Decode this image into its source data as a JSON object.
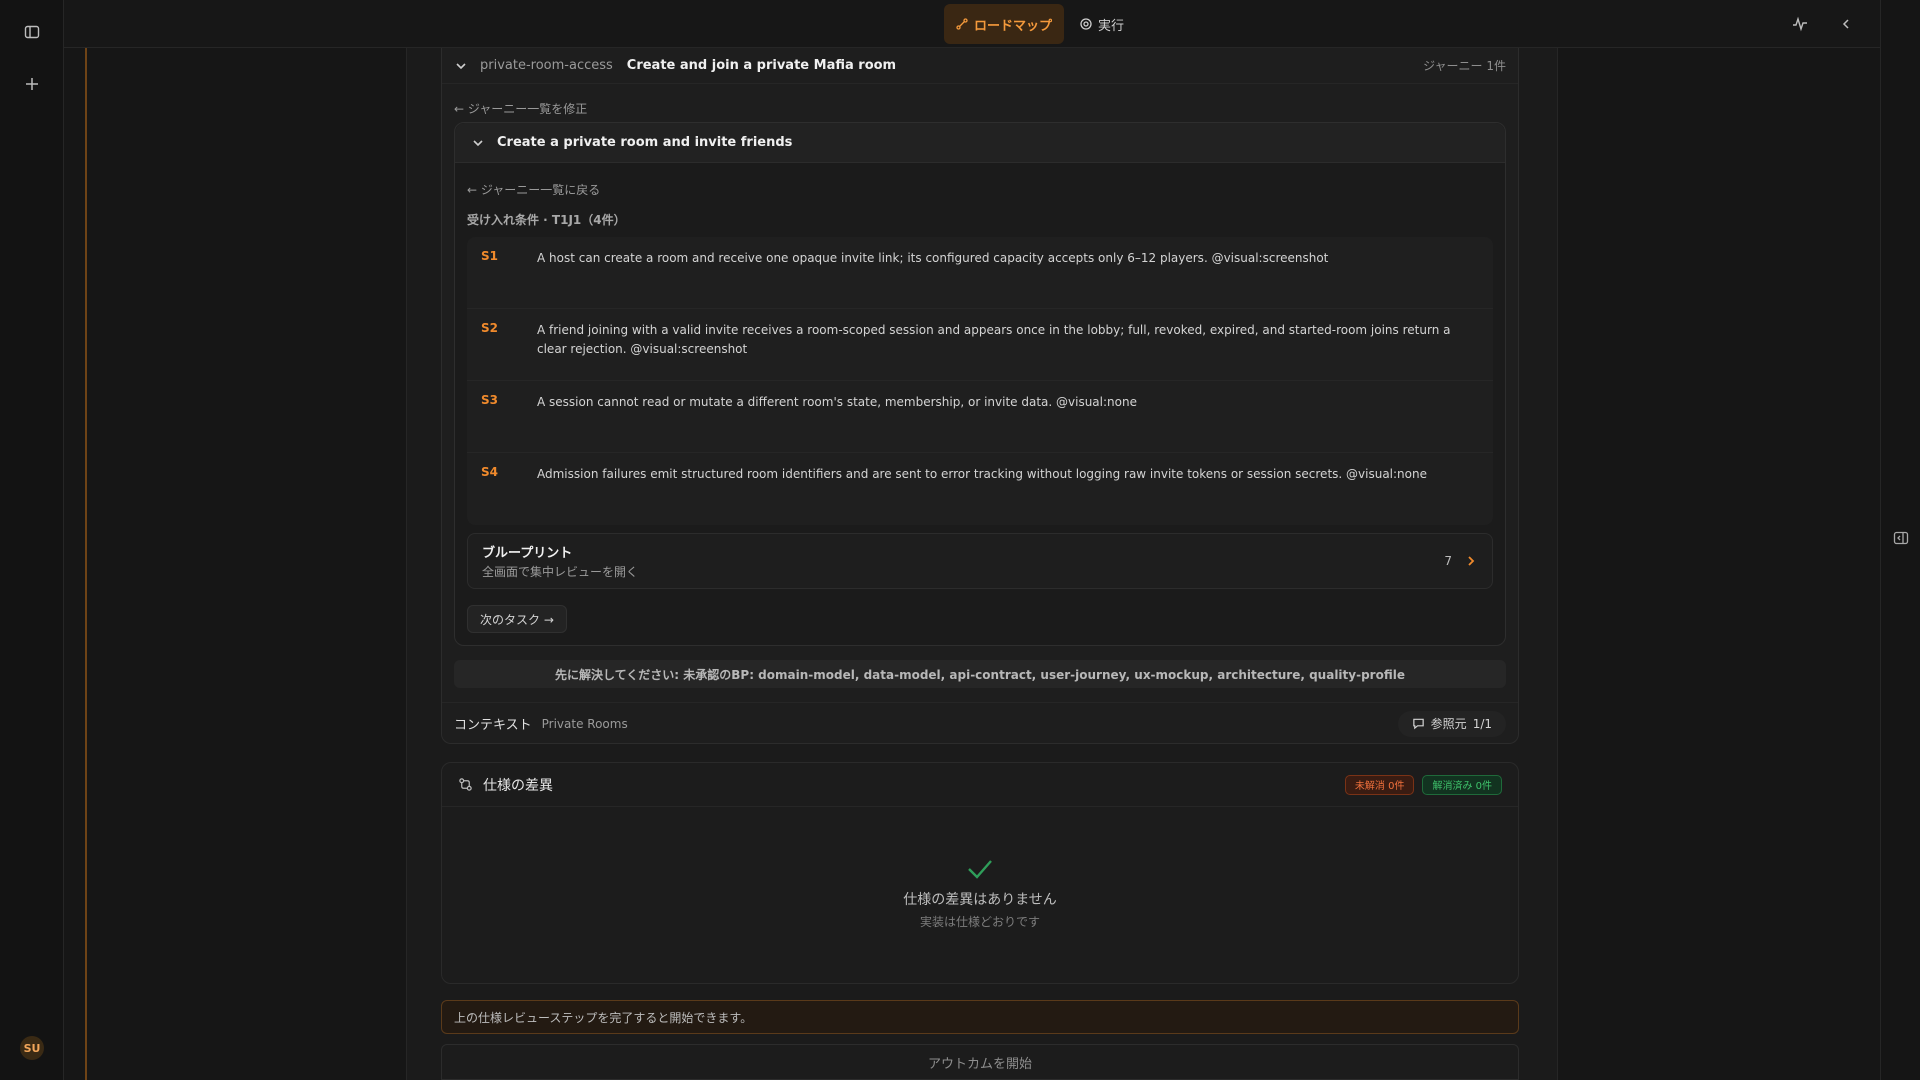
{
  "topbar": {
    "tabs": [
      {
        "label": "ロードマップ",
        "icon": "roadmap-icon",
        "active": true
      },
      {
        "label": "実行",
        "icon": "target-icon",
        "active": false
      }
    ]
  },
  "journey": {
    "slug": "private-room-access",
    "title": "Create and join a private Mafia room",
    "count": "ジャーニー 1件",
    "back_link": "← ジャーニー一覧を修正",
    "task": {
      "title": "Create a private room and invite friends",
      "back_link": "← ジャーニー一覧に戻る",
      "criteria_label": "受け入れ条件 · T1J1（4件）",
      "criteria": [
        {
          "id": "S1",
          "text": "A host can create a room and receive one opaque invite link; its configured capacity accepts only 6–12 players. @visual:screenshot"
        },
        {
          "id": "S2",
          "text": "A friend joining with a valid invite receives a room-scoped session and appears once in the lobby; full, revoked, expired, and started-room joins return a clear rejection. @visual:screenshot"
        },
        {
          "id": "S3",
          "text": "A session cannot read or mutate a different room's state, membership, or invite data. @visual:none"
        },
        {
          "id": "S4",
          "text": "Admission failures emit structured room identifiers and are sent to error tracking without logging raw invite tokens or session secrets. @visual:none"
        }
      ],
      "blueprint": {
        "title": "ブループリント",
        "subtitle": "全画面で集中レビューを開く",
        "count": "7"
      },
      "next_label": "次のタスク →"
    },
    "warning": "先に解決してください: 未承認のBP: domain-model, data-model, api-contract, user-journey, ux-mockup, architecture, quality-profile",
    "context": {
      "label": "コンテキスト",
      "value": "Private Rooms",
      "ref_label": "参照元",
      "ref_count": "1/1"
    }
  },
  "spec_diff": {
    "title": "仕様の差異",
    "unresolved": "未解消 0件",
    "resolved": "解消済み 0件",
    "empty_title": "仕様の差異はありません",
    "empty_sub": "実装は仕様どおりです"
  },
  "notice": "上の仕様レビューステップを完了すると開始できます。",
  "start_button": "アウトカムを開始",
  "user": {
    "initials": "SU"
  },
  "colors": {
    "accent": "#f08a2c",
    "success": "#3ec06a",
    "danger": "#f0703c"
  }
}
